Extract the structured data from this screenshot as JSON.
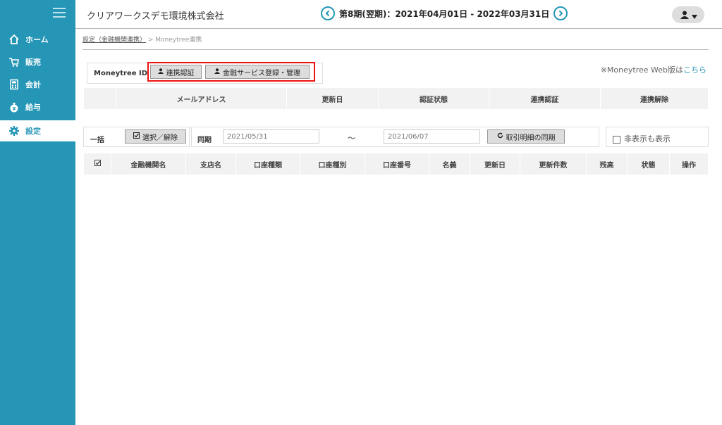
{
  "header": {
    "company": "クリアワークスデモ環境株式会社",
    "period": "第8期(翌期)：2021年04月01日 - 2022年03月31日"
  },
  "sidebar": {
    "items": [
      {
        "label": "ホーム",
        "icon": "home-icon"
      },
      {
        "label": "販売",
        "icon": "cart-icon"
      },
      {
        "label": "会計",
        "icon": "calculator-icon"
      },
      {
        "label": "給与",
        "icon": "money-bag-icon"
      },
      {
        "label": "設定",
        "icon": "gear-icon"
      }
    ]
  },
  "breadcrumb": {
    "parent": "設定（金融機関連携）",
    "separator": " > ",
    "current": "Moneytree連携"
  },
  "moneytree": {
    "label": "Moneytree ID",
    "auth_button": "連携認証",
    "manage_button": "金融サービス登録・管理",
    "web_note": "※Moneytree Web版は",
    "web_link": "こちら"
  },
  "account_table": {
    "headers": [
      "",
      "メールアドレス",
      "更新日",
      "認証状態",
      "連携認証",
      "連携解除"
    ]
  },
  "filter": {
    "bulk_label": "一括",
    "select_button": "選択／解除",
    "sync_label": "同期",
    "date_from": "2021/05/31",
    "tilde": "～",
    "date_to": "2021/06/07",
    "sync_button": "取引明細の同期",
    "show_hidden": "非表示も表示"
  },
  "bank_table": {
    "headers": [
      "",
      "金融機関名",
      "支店名",
      "口座種類",
      "口座種別",
      "口座番号",
      "名義",
      "更新日",
      "更新件数",
      "残高",
      "状態",
      "操作"
    ]
  },
  "colors": {
    "accent": "#2596b6",
    "highlight_frame": "#e11111"
  }
}
